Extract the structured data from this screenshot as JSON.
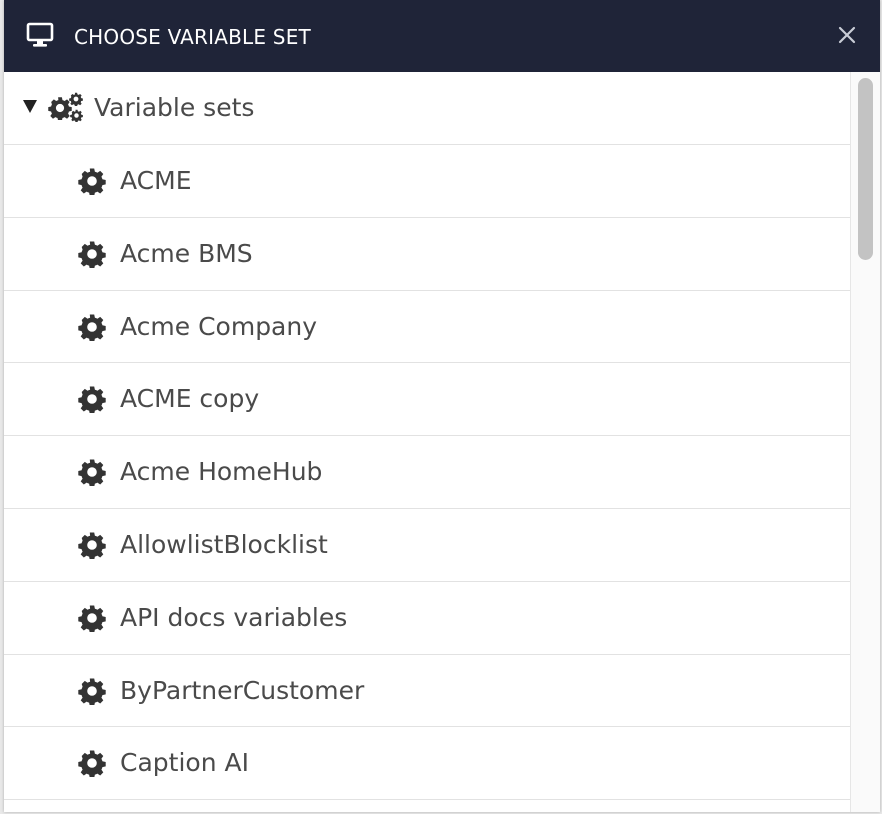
{
  "dialog": {
    "title": "CHOOSE VARIABLE SET",
    "title_icon": "monitor-icon",
    "close_icon": "close-icon"
  },
  "tree": {
    "root": {
      "label": "Variable sets",
      "expanded": true,
      "icon": "gears-icon"
    },
    "items": [
      {
        "label": "ACME",
        "icon": "gear-icon"
      },
      {
        "label": "Acme BMS",
        "icon": "gear-icon"
      },
      {
        "label": "Acme Company",
        "icon": "gear-icon"
      },
      {
        "label": "ACME copy",
        "icon": "gear-icon"
      },
      {
        "label": "Acme HomeHub",
        "icon": "gear-icon"
      },
      {
        "label": "AllowlistBlocklist",
        "icon": "gear-icon"
      },
      {
        "label": "API docs variables",
        "icon": "gear-icon"
      },
      {
        "label": "ByPartnerCustomer",
        "icon": "gear-icon"
      },
      {
        "label": "Caption AI",
        "icon": "gear-icon"
      }
    ]
  },
  "colors": {
    "header_bg": "#1f2438",
    "text": "#4a4a4a",
    "divider": "#e2e2e2"
  }
}
